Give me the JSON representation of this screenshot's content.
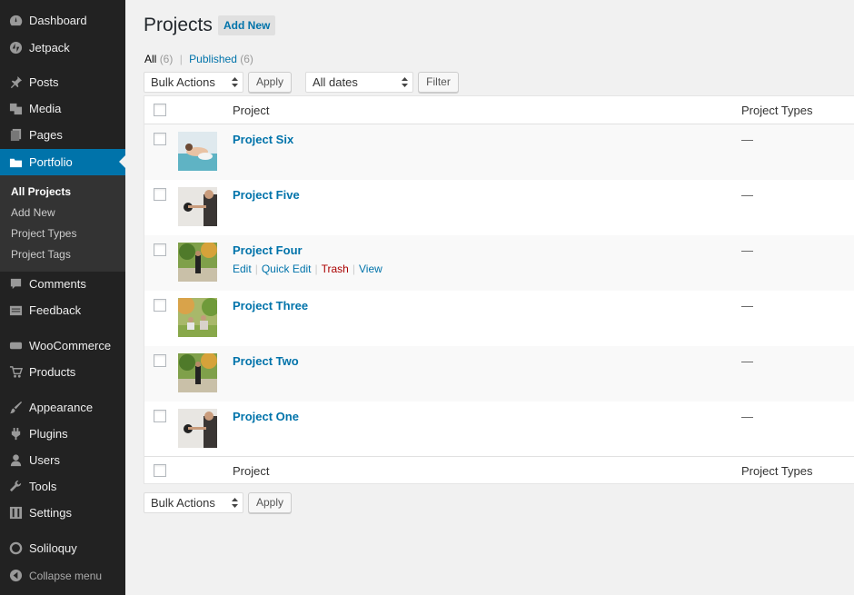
{
  "sidebar": {
    "items": [
      {
        "label": "Dashboard",
        "icon": "dashboard-icon"
      },
      {
        "label": "Jetpack",
        "icon": "jetpack-icon"
      },
      {
        "label": "Posts",
        "icon": "pin-icon"
      },
      {
        "label": "Media",
        "icon": "media-icon"
      },
      {
        "label": "Pages",
        "icon": "pages-icon"
      },
      {
        "label": "Portfolio",
        "icon": "folder-icon"
      },
      {
        "label": "Comments",
        "icon": "comment-icon"
      },
      {
        "label": "Feedback",
        "icon": "feedback-icon"
      },
      {
        "label": "WooCommerce",
        "icon": "woocommerce-icon"
      },
      {
        "label": "Products",
        "icon": "cart-icon"
      },
      {
        "label": "Appearance",
        "icon": "brush-icon"
      },
      {
        "label": "Plugins",
        "icon": "plugin-icon"
      },
      {
        "label": "Users",
        "icon": "user-icon"
      },
      {
        "label": "Tools",
        "icon": "wrench-icon"
      },
      {
        "label": "Settings",
        "icon": "sliders-icon"
      },
      {
        "label": "Soliloquy",
        "icon": "soliloquy-icon"
      }
    ],
    "submenu": [
      "All Projects",
      "Add New",
      "Project Types",
      "Project Tags"
    ],
    "collapse_label": "Collapse menu"
  },
  "page": {
    "title": "Projects",
    "add_new": "Add New"
  },
  "views": {
    "all_label": "All",
    "all_count": "(6)",
    "separator": "|",
    "published_label": "Published",
    "published_count": "(6)"
  },
  "toolbar": {
    "bulk_actions": "Bulk Actions",
    "apply": "Apply",
    "dates": "All dates",
    "filter": "Filter"
  },
  "table": {
    "columns": [
      "Project",
      "Project Types"
    ],
    "rows": [
      {
        "title": "Project Six",
        "types": "—"
      },
      {
        "title": "Project Five",
        "types": "—"
      },
      {
        "title": "Project Four",
        "types": "—"
      },
      {
        "title": "Project Three",
        "types": "—"
      },
      {
        "title": "Project Two",
        "types": "—"
      },
      {
        "title": "Project One",
        "types": "—"
      }
    ],
    "row_actions": {
      "edit": "Edit",
      "quick_edit": "Quick Edit",
      "trash": "Trash",
      "view": "View",
      "sep": "|"
    }
  },
  "colors": {
    "accent": "#0073aa",
    "sidebar": "#222222",
    "trash": "#aa0000"
  }
}
